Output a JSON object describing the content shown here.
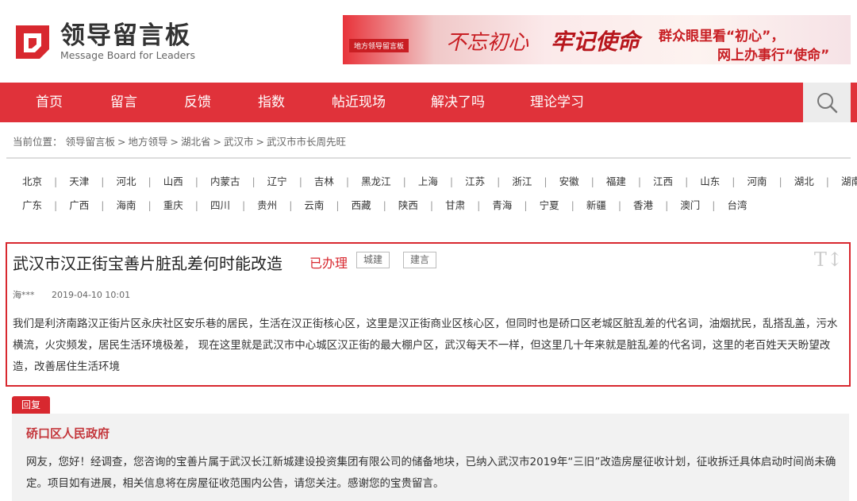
{
  "site": {
    "name": "领导留言板",
    "name_en": "Message Board for Leaders"
  },
  "banner": {
    "badge": "地方领导留言板",
    "slogan_a": "不忘初心",
    "slogan_b": "牢记使命",
    "line1": "群众眼里看“初心”，",
    "line2": "网上办事行“使命”"
  },
  "nav": {
    "items": [
      "首页",
      "留言",
      "反馈",
      "指数",
      "帖近现场",
      "解决了吗",
      "理论学习"
    ]
  },
  "breadcrumb": {
    "prefix": "当前位置：",
    "items": [
      "领导留言板",
      "地方领导",
      "湖北省",
      "武汉市",
      "武汉市市长周先旺"
    ]
  },
  "regions": {
    "row1": [
      "北京",
      "天津",
      "河北",
      "山西",
      "内蒙古",
      "辽宁",
      "吉林",
      "黑龙江",
      "上海",
      "江苏",
      "浙江",
      "安徽",
      "福建",
      "江西",
      "山东",
      "河南",
      "湖北",
      "湖南"
    ],
    "row2": [
      "广东",
      "广西",
      "海南",
      "重庆",
      "四川",
      "贵州",
      "云南",
      "西藏",
      "陕西",
      "甘肃",
      "青海",
      "宁夏",
      "新疆",
      "香港",
      "澳门",
      "台湾"
    ]
  },
  "message": {
    "title": "武汉市汉正街宝善片脏乱差何时能改造",
    "status": "已办理",
    "tags": [
      "城建",
      "建言"
    ],
    "font_toggle": "T↕",
    "author": "海***",
    "date": "2019-04-10 10:01",
    "body": "我们是利济南路汉正街片区永庆社区安乐巷的居民，生活在汉正街核心区，这里是汉正街商业区核心区，但同时也是硚口区老城区脏乱差的代名词，油烟扰民，乱搭乱盖，污水横流，火灾频发，居民生活环境极差， 现在这里就是武汉市中心城区汉正街的最大棚户区，武汉每天不一样，但这里几十年来就是脏乱差的代名词，这里的老百姓天天盼望改造，改善居住生活环境"
  },
  "reply": {
    "label": "回复",
    "org": "硚口区人民政府",
    "body": "网友，您好！经调查，您咨询的宝善片属于武汉长江新城建设投资集团有限公司的储备地块，已纳入武汉市2019年“三旧”改造房屋征收计划，征收拆迁具体启动时间尚未确定。项目如有进展，相关信息将在房屋征收范围内公告，请您关注。感谢您的宝贵留言。"
  },
  "colors": {
    "brand_red": "#e0323a",
    "status_red": "#d8282f",
    "reply_bg": "#f2f2f2"
  }
}
